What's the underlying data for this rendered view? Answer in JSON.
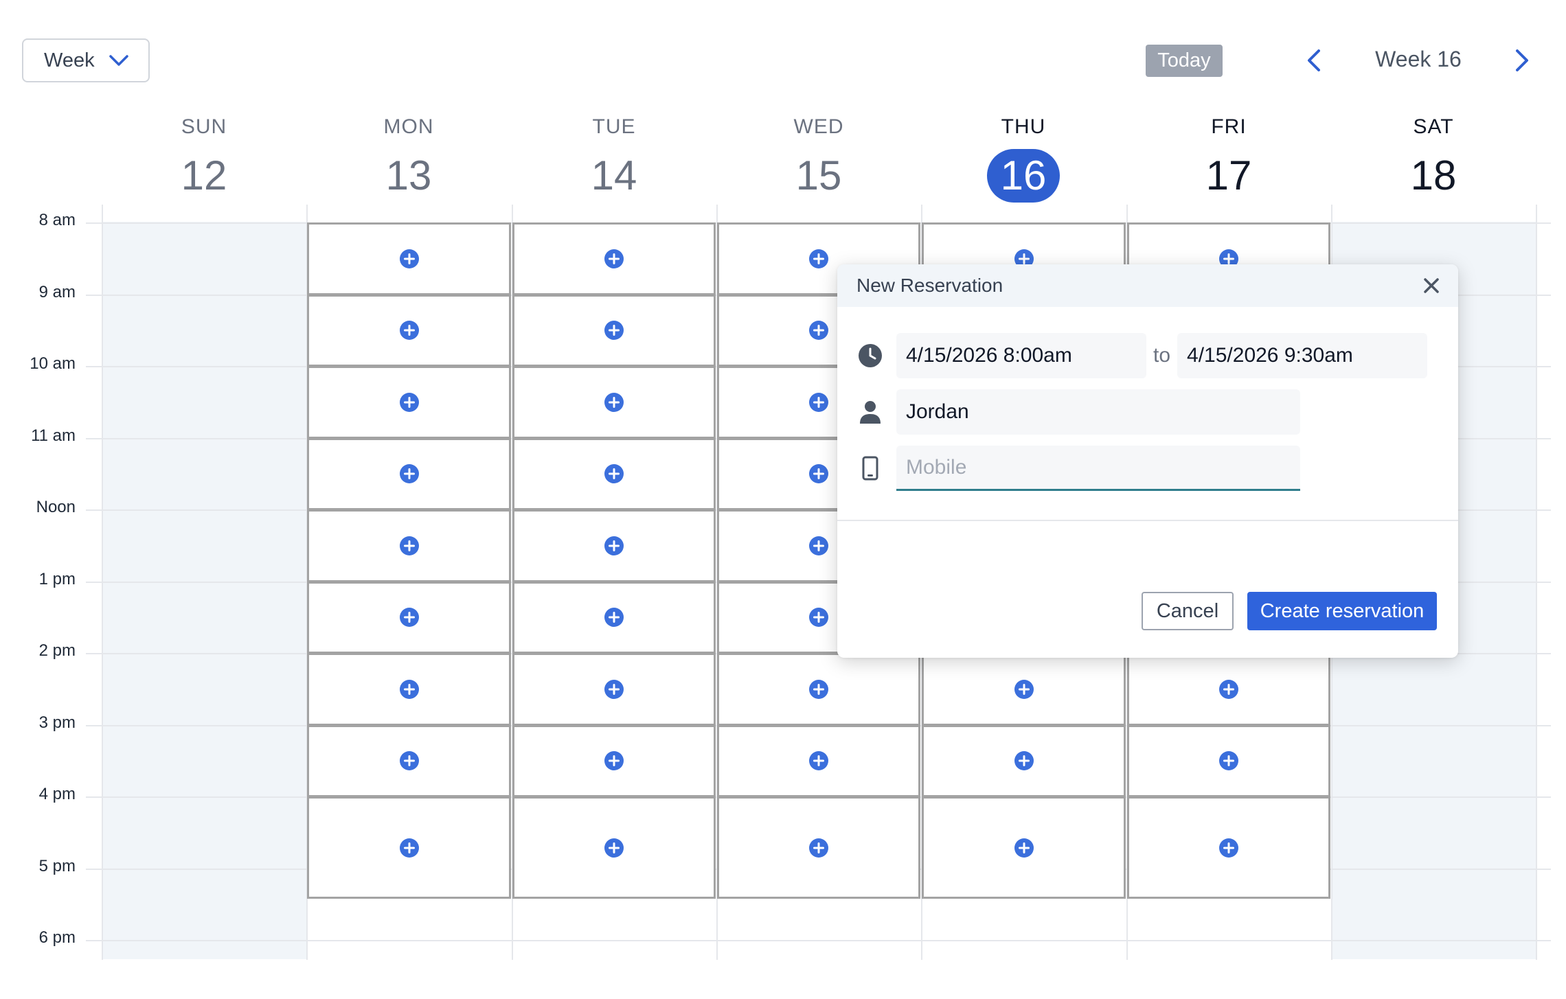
{
  "toolbar": {
    "view_label": "Week",
    "today_label": "Today",
    "week_label": "Week 16"
  },
  "days": [
    {
      "dow": "SUN",
      "num": "12",
      "state": "past-weekend"
    },
    {
      "dow": "MON",
      "num": "13",
      "state": "past"
    },
    {
      "dow": "TUE",
      "num": "14",
      "state": "past"
    },
    {
      "dow": "WED",
      "num": "15",
      "state": "past"
    },
    {
      "dow": "THU",
      "num": "16",
      "state": "today"
    },
    {
      "dow": "FRI",
      "num": "17",
      "state": "future"
    },
    {
      "dow": "SAT",
      "num": "18",
      "state": "future-weekend"
    }
  ],
  "hours": [
    "8 am",
    "9 am",
    "10 am",
    "11 am",
    "Noon",
    "1 pm",
    "2 pm",
    "3 pm",
    "4 pm",
    "5 pm",
    "6 pm"
  ],
  "colors": {
    "accent": "#2f5fd0",
    "plus_icon": "#3b6fdc",
    "weekend_bg": "#f1f5f9"
  },
  "dialog": {
    "title": "New Reservation",
    "start": "4/15/2026 8:00am",
    "to": "to",
    "end": "4/15/2026 9:30am",
    "name": "Jordan",
    "mobile_placeholder": "Mobile",
    "cancel_label": "Cancel",
    "create_label": "Create reservation"
  }
}
